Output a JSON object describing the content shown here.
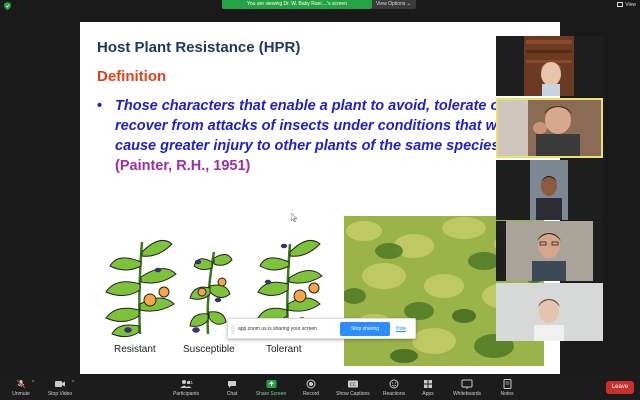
{
  "top": {
    "banner": "You are viewing Dr. W. Baby Rani ...'s screen",
    "view_options": "View Options",
    "view": "View"
  },
  "slide": {
    "title": "Host Plant Resistance (HPR)",
    "definition": "Definition",
    "bullet": "•",
    "body": "Those characters that enable a plant to avoid, tolerate or recover from attacks of insects under conditions that would cause greater injury to other plants of the same species”",
    "citation": "(Painter, R.H., 1951)",
    "labels": [
      "Resistant",
      "Susceptible",
      "Tolerant"
    ]
  },
  "share": {
    "message": "app.zoom.us is sharing your screen.",
    "stop": "Stop sharing",
    "hide": "Hide"
  },
  "toolbar": {
    "unmute": "Unmute",
    "stop_video": "Stop Video",
    "participants": "Participants",
    "participants_count": "51",
    "chat": "Chat",
    "share_screen": "Share Screen",
    "record": "Record",
    "show_captions": "Show Captions",
    "reactions": "Reactions",
    "apps": "Apps",
    "whiteboards": "Whiteboards",
    "notes": "Notes",
    "leave": "Leave"
  },
  "colors": {
    "accent_green": "#25a244",
    "share_blue": "#2d8cff",
    "leave_red": "#c8322d",
    "title_blue": "#1f3864",
    "def_red": "#e0401a",
    "body_blue": "#1f1fd0",
    "cite_purple": "#9b2ea8"
  }
}
